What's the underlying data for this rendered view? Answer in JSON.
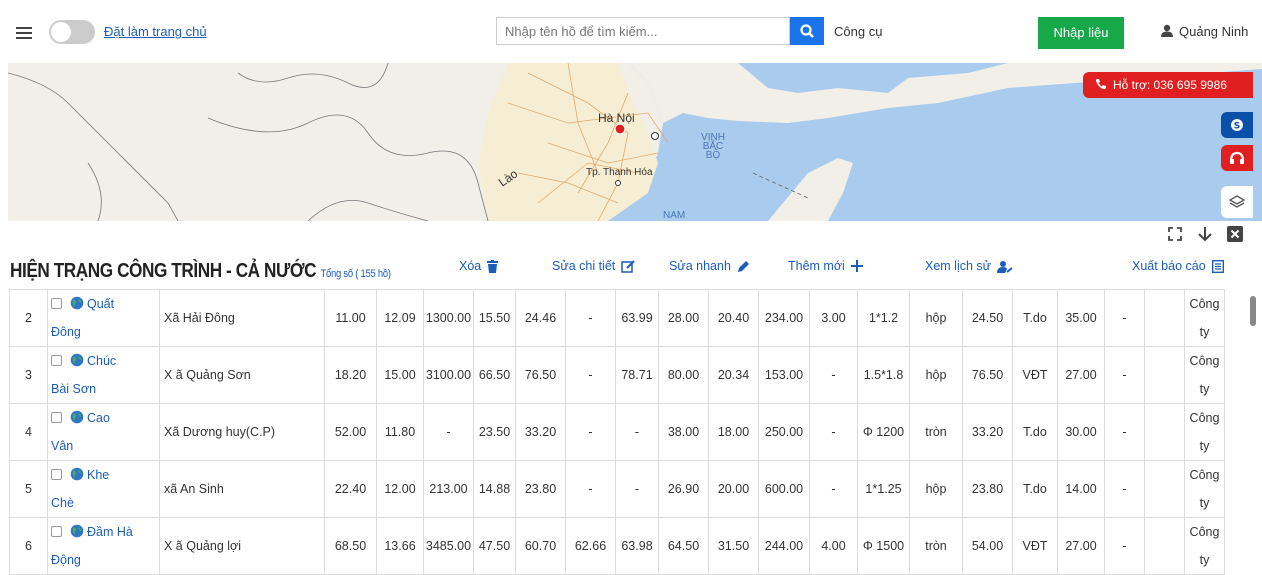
{
  "topbar": {
    "home_link": "Đặt làm trang chủ",
    "search_placeholder": "Nhập tên hồ để tìm kiếm...",
    "tools": "Công cụ",
    "import_button": "Nhập liệu",
    "user_name": "Quảng Ninh"
  },
  "map": {
    "labels": {
      "hanoi": "Hà Nội",
      "lao": "Lào",
      "thanhhoa": "Tp. Thanh Hóa",
      "nam": "NAM"
    },
    "sea_label": "VỊNH BẮC BỘ",
    "hotline": "Hỗ trợ: 036 695 9986"
  },
  "section": {
    "title": "HIỆN TRẠNG CÔNG TRÌNH - CẢ NƯỚC",
    "total": "Tổng số ( 155 hồ)",
    "actions": {
      "delete": "Xóa",
      "edit_detail": "Sửa chi tiết",
      "quick_edit": "Sửa nhanh",
      "add_new": "Thêm mới",
      "history": "Xem lịch sử",
      "export": "Xuất báo cáo"
    }
  },
  "rows": [
    {
      "stt": "2",
      "name_1": "Quất",
      "name_2": "Đông",
      "commune": "Xã Hải Đông",
      "c1": "11.00",
      "c2": "12.09",
      "c3": "1300.00",
      "c4": "15.50",
      "c5": "24.46",
      "c6": "-",
      "c7": "63.99",
      "c8": "28.00",
      "c9": "20.40",
      "c10": "234.00",
      "c11": "3.00",
      "c12": "1*1.2",
      "c13": "hộp",
      "c14": "24.50",
      "c15": "T.do",
      "c16": "35.00",
      "c17": "-",
      "c18": "",
      "owner_1": "Công",
      "owner_2": "ty"
    },
    {
      "stt": "3",
      "name_1": "Chúc",
      "name_2": "Bài Sơn",
      "commune": "X ã Quảng Sơn",
      "c1": "18.20",
      "c2": "15.00",
      "c3": "3100.00",
      "c4": "66.50",
      "c5": "76.50",
      "c6": "-",
      "c7": "78.71",
      "c8": "80.00",
      "c9": "20.34",
      "c10": "153.00",
      "c11": "-",
      "c12": "1.5*1.8",
      "c13": "hộp",
      "c14": "76.50",
      "c15": "VĐT",
      "c16": "27.00",
      "c17": "-",
      "c18": "",
      "owner_1": "Công",
      "owner_2": "ty"
    },
    {
      "stt": "4",
      "name_1": "Cao",
      "name_2": "Vân",
      "commune": "Xã Dương huy(C.P)",
      "c1": "52.00",
      "c2": "11.80",
      "c3": "-",
      "c4": "23.50",
      "c5": "33.20",
      "c6": "-",
      "c7": "-",
      "c8": "38.00",
      "c9": "18.00",
      "c10": "250.00",
      "c11": "-",
      "c12": "Φ 1200",
      "c13": "tròn",
      "c14": "33.20",
      "c15": "T.do",
      "c16": "30.00",
      "c17": "-",
      "c18": "",
      "owner_1": "Công",
      "owner_2": "ty"
    },
    {
      "stt": "5",
      "name_1": "Khe",
      "name_2": "Chè",
      "commune": "xã An Sinh",
      "c1": "22.40",
      "c2": "12.00",
      "c3": "213.00",
      "c4": "14.88",
      "c5": "23.80",
      "c6": "-",
      "c7": "-",
      "c8": "26.90",
      "c9": "20.00",
      "c10": "600.00",
      "c11": "-",
      "c12": "1*1.25",
      "c13": "hộp",
      "c14": "23.80",
      "c15": "T.do",
      "c16": "14.00",
      "c17": "-",
      "c18": "",
      "owner_1": "Công",
      "owner_2": "ty"
    },
    {
      "stt": "6",
      "name_1": "Đầm Hà",
      "name_2": "Động",
      "commune": "X ã Quảng lợi",
      "c1": "68.50",
      "c2": "13.66",
      "c3": "3485.00",
      "c4": "47.50",
      "c5": "60.70",
      "c6": "62.66",
      "c7": "63.98",
      "c8": "64.50",
      "c9": "31.50",
      "c10": "244.00",
      "c11": "4.00",
      "c12": "Φ 1500",
      "c13": "tròn",
      "c14": "54.00",
      "c15": "VĐT",
      "c16": "27.00",
      "c17": "-",
      "c18": "",
      "owner_1": "Công",
      "owner_2": "ty"
    }
  ],
  "colors": {
    "primary": "#1a73e8",
    "link": "#1b5db8",
    "success": "#17a84a",
    "danger": "#e02020",
    "sea": "#a9cbee",
    "land": "#f2efe9"
  },
  "icons": [
    "menu-icon",
    "search-icon",
    "user-icon",
    "phone-icon",
    "skype-icon",
    "headset-icon",
    "layers-icon",
    "fullscreen-icon",
    "download-icon",
    "close-icon",
    "trash-icon",
    "edit-icon",
    "pencil-icon",
    "plus-icon",
    "user-history-icon",
    "report-icon",
    "globe-icon"
  ]
}
